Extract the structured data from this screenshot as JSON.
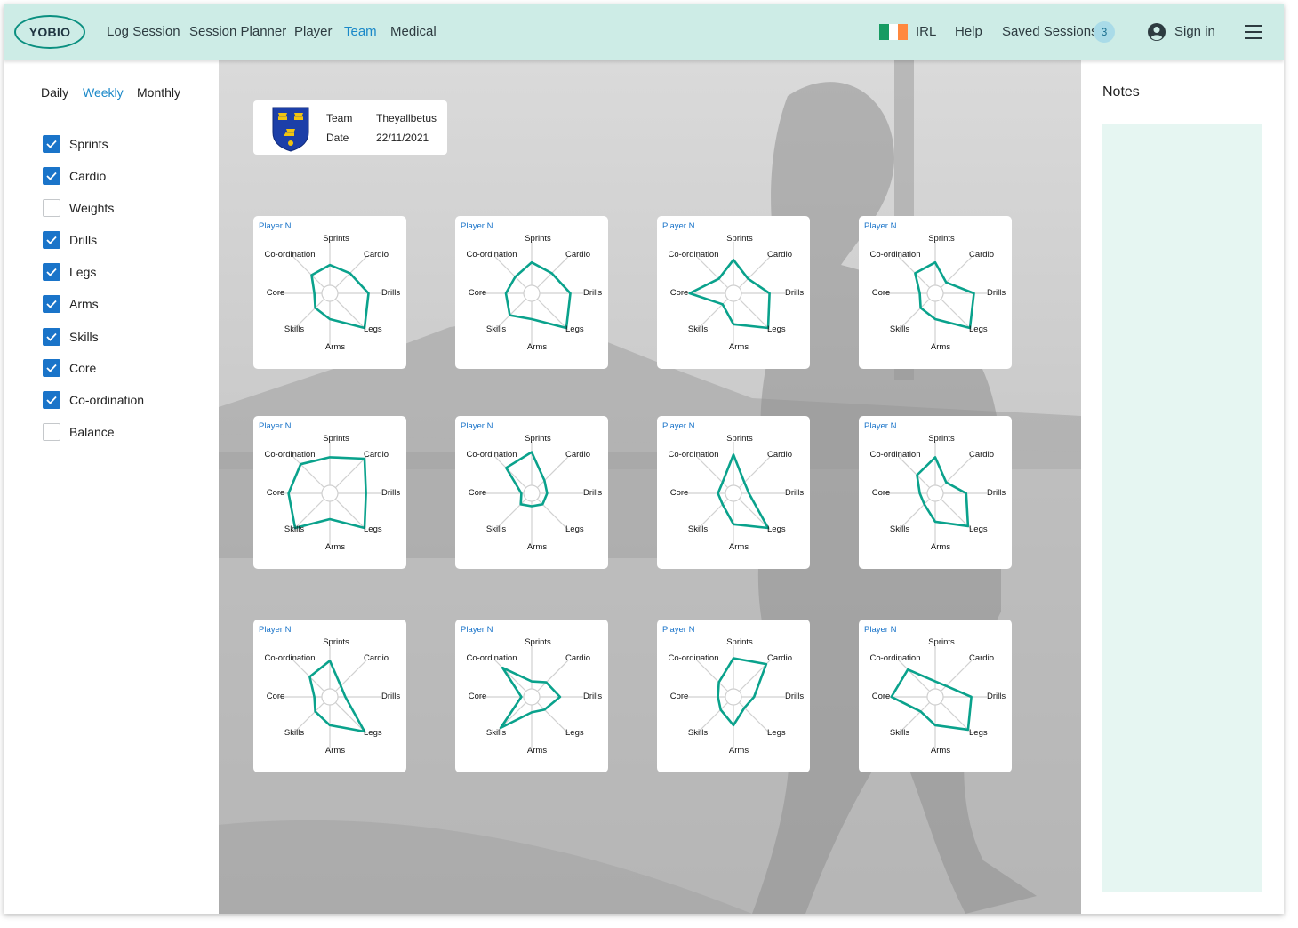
{
  "header": {
    "logo": "YOBIO",
    "nav": [
      {
        "label": "Log Session",
        "active": false
      },
      {
        "label": "Session Planner",
        "active": false
      },
      {
        "label": "Player",
        "active": false
      },
      {
        "label": "Team",
        "active": true
      },
      {
        "label": "Medical",
        "active": false
      }
    ],
    "country": "IRL",
    "help": "Help",
    "saved_sessions": "Saved Sessions",
    "saved_count": "3",
    "sign_in": "Sign in",
    "flag_colors": [
      "#169b62",
      "#ffffff",
      "#ff883e"
    ]
  },
  "filters": {
    "periods": [
      {
        "label": "Daily",
        "active": false
      },
      {
        "label": "Weekly",
        "active": true
      },
      {
        "label": "Monthly",
        "active": false
      }
    ],
    "items": [
      {
        "label": "Sprints",
        "checked": true
      },
      {
        "label": "Cardio",
        "checked": true
      },
      {
        "label": "Weights",
        "checked": false
      },
      {
        "label": "Drills",
        "checked": true
      },
      {
        "label": "Legs",
        "checked": true
      },
      {
        "label": "Arms",
        "checked": true
      },
      {
        "label": "Skills",
        "checked": true
      },
      {
        "label": "Core",
        "checked": true
      },
      {
        "label": "Co-ordination",
        "checked": true
      },
      {
        "label": "Balance",
        "checked": false
      }
    ]
  },
  "team_info": {
    "team_label": "Team",
    "team_value": "Theyallbetus",
    "date_label": "Date",
    "date_value": "22/11/2021"
  },
  "radar": {
    "axes": [
      "Sprints",
      "Cardio",
      "Drills",
      "Legs",
      "Arms",
      "Skills",
      "Core",
      "Co-ordination"
    ],
    "line_color": "#0aa28c",
    "players": [
      {
        "name": "Player N",
        "values": [
          0.55,
          0.55,
          0.75,
          0.95,
          0.5,
          0.4,
          0.3,
          0.5
        ]
      },
      {
        "name": "Player N",
        "values": [
          0.6,
          0.55,
          0.75,
          0.95,
          0.5,
          0.6,
          0.5,
          0.45
        ]
      },
      {
        "name": "Player N",
        "values": [
          0.65,
          0.4,
          0.7,
          0.95,
          0.6,
          0.3,
          0.85,
          0.4
        ]
      },
      {
        "name": "Player N",
        "values": [
          0.6,
          0.3,
          0.75,
          0.95,
          0.5,
          0.4,
          0.3,
          0.55
        ]
      },
      {
        "name": "Player N",
        "values": [
          0.7,
          0.95,
          0.7,
          0.95,
          0.5,
          0.95,
          0.8,
          0.8
        ]
      },
      {
        "name": "Player N",
        "values": [
          0.8,
          0.35,
          0.3,
          0.3,
          0.25,
          0.3,
          0.2,
          0.7
        ]
      },
      {
        "name": "Player N",
        "values": [
          0.75,
          0.3,
          0.3,
          0.95,
          0.6,
          0.3,
          0.3,
          0.3
        ]
      },
      {
        "name": "Player N",
        "values": [
          0.7,
          0.3,
          0.6,
          0.9,
          0.55,
          0.3,
          0.3,
          0.5
        ]
      },
      {
        "name": "Player N",
        "values": [
          0.7,
          0.3,
          0.3,
          0.95,
          0.55,
          0.4,
          0.3,
          0.55
        ]
      },
      {
        "name": "Player N",
        "values": [
          0.3,
          0.4,
          0.55,
          0.35,
          0.3,
          0.85,
          0.2,
          0.8
        ]
      },
      {
        "name": "Player N",
        "values": [
          0.75,
          0.9,
          0.4,
          0.3,
          0.55,
          0.35,
          0.3,
          0.4
        ]
      },
      {
        "name": "Player N",
        "values": [
          0.3,
          0.3,
          0.7,
          0.9,
          0.55,
          0.4,
          0.85,
          0.75
        ]
      }
    ]
  },
  "notes": {
    "title": "Notes"
  }
}
